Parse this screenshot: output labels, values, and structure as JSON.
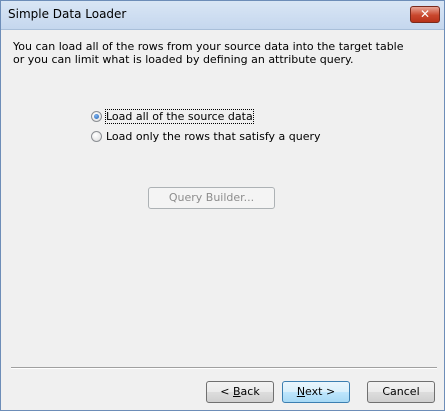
{
  "window": {
    "title": "Simple Data Loader",
    "close_glyph": "✕"
  },
  "description": {
    "line1": "You can load all of the rows from your source data into the target table",
    "line2": "or you can limit what is loaded by defining an attribute query."
  },
  "options": [
    {
      "label": "Load all of the source data",
      "checked": true
    },
    {
      "label": "Load only the rows that satisfy a query",
      "checked": false
    }
  ],
  "query_builder": {
    "label": "Query Builder...",
    "enabled": false
  },
  "footer": {
    "back_prefix": "< ",
    "back_mnemonic": "B",
    "back_rest": "ack",
    "next_mnemonic": "N",
    "next_rest": "ext >",
    "cancel_label": "Cancel"
  },
  "colors": {
    "titlebar": "#c5d7ee",
    "close_button": "#c9472d",
    "default_button_border": "#3c7fb1"
  }
}
